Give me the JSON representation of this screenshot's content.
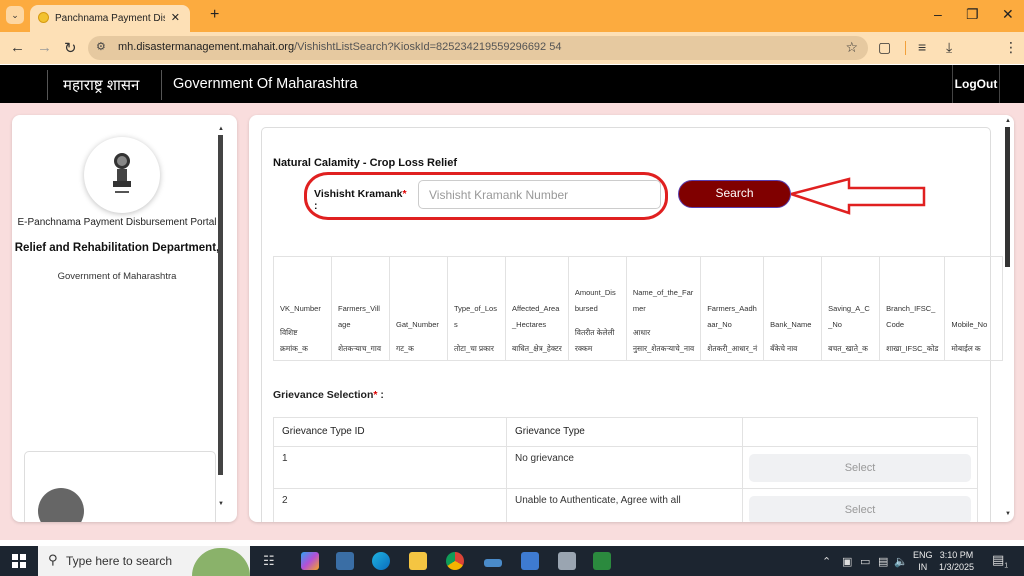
{
  "browser": {
    "tab_title": "Panchnama Payment Disbursem",
    "url_host": "mh.disastermanagement.mahait.org",
    "url_rest": "/VishishtListSearch?KioskId=825234219559296692 54",
    "icons": {
      "tab_menu": "chevron-down-icon",
      "close": "close-icon",
      "new_tab": "plus-icon",
      "back": "back-arrow-icon",
      "forward": "forward-arrow-icon",
      "reload": "reload-icon",
      "site_info": "tune-icon",
      "bookmark": "star-icon",
      "extensions": "puzzle-icon",
      "media": "media-queue-icon",
      "download": "download-icon",
      "menu": "kebab-menu-icon"
    }
  },
  "header": {
    "marathi_title": "महाराष्ट्र शासन",
    "title": "Government Of Maharashtra",
    "logout": "LogOut"
  },
  "sidebar": {
    "portal": "E-Panchnama Payment Disbursement Portal",
    "department": "Relief and Rehabilitation Department,",
    "government": "Government of Maharashtra"
  },
  "form": {
    "section_title": "Natural Calamity - Crop Loss Relief",
    "vk_label": "Vishisht Kramank",
    "required_mark": "*",
    "colon": ":",
    "vk_value": "",
    "vk_placeholder": "Vishisht Kramank Number",
    "search_label": "Search",
    "highlight_color": "#e02020",
    "search_color": "#800000"
  },
  "vk_table": {
    "columns": [
      {
        "en": "VK_Number",
        "mr": "विशिष्ट क्रमांक_क"
      },
      {
        "en": "Farmers_Village",
        "mr": "शेतकऱ्याच_गाव"
      },
      {
        "en": "Gat_Number",
        "mr": "गट_क"
      },
      {
        "en": "Type_of_Loss",
        "mr": "तोटा_चा प्रकार"
      },
      {
        "en": "Affected_Area_Hectares",
        "mr": "बाधित_क्षेत्र_हेक्टर"
      },
      {
        "en": "Amount_Disbursed",
        "mr": "वितरीत केलेली रक्कम"
      },
      {
        "en": "Name_of_the_Farmer",
        "mr": "आधार नुसार_शेतकऱ्याचे_नाव"
      },
      {
        "en": "Farmers_Aadhaar_No",
        "mr": "शेतकरी_आधार_नं"
      },
      {
        "en": "Bank_Name",
        "mr": "बँकेचे नाव"
      },
      {
        "en": "Saving_A_C_No",
        "mr": "बचत_खाते_क"
      },
      {
        "en": "Branch_IFSC_Code",
        "mr": "शाखा_IFSC_कोड"
      },
      {
        "en": "Mobile_No",
        "mr": "मोबाईल क"
      }
    ]
  },
  "grievance": {
    "label": "Grievance Selection",
    "required_mark": "*",
    "colon": " :",
    "headers": [
      "Grievance Type ID",
      "Grievance Type",
      ""
    ],
    "rows": [
      {
        "id": "1",
        "type": "No grievance",
        "action": "Select"
      },
      {
        "id": "2",
        "type": "Unable to Authenticate, Agree with all",
        "action": "Select"
      }
    ]
  },
  "taskbar": {
    "search_placeholder": "Type here to search",
    "lang_top": "ENG",
    "lang_bottom": "IN",
    "time": "3:10 PM",
    "date": "1/3/2025",
    "notification_count": "1"
  }
}
